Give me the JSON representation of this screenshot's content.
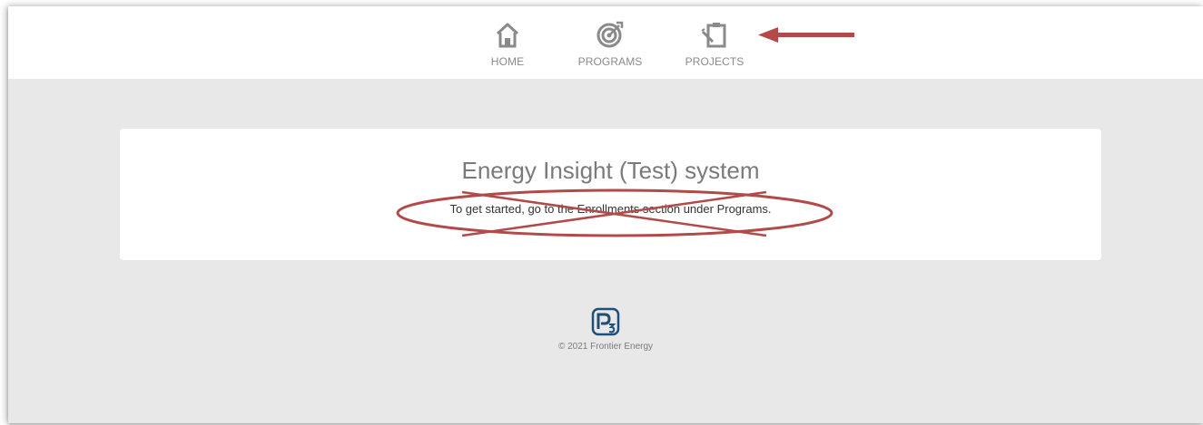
{
  "nav": {
    "items": [
      {
        "label": "HOME",
        "icon": "home-icon"
      },
      {
        "label": "PROGRAMS",
        "icon": "target-icon"
      },
      {
        "label": "PROJECTS",
        "icon": "clipboard-icon"
      }
    ]
  },
  "main": {
    "title": "Energy Insight (Test) system",
    "text": "To get started, go to the Enrollments section under Programs."
  },
  "footer": {
    "logo": "P3",
    "copyright": "© 2021 Frontier Energy"
  },
  "colors": {
    "accent": "#b24a49",
    "nav_icon": "#8a8a8a",
    "logo_blue": "#1f4e79",
    "background": "#e8e8e8"
  }
}
